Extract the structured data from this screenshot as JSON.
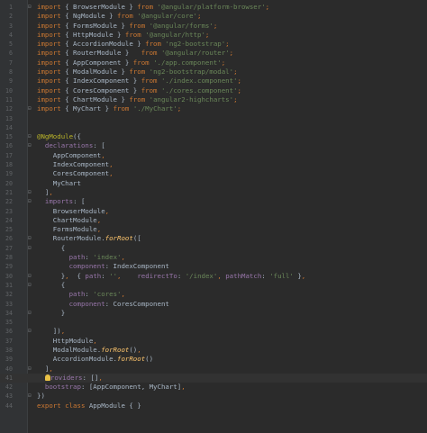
{
  "editor": {
    "lines": [
      {
        "n": "1",
        "tokens": [
          [
            "kw",
            "import"
          ],
          [
            "t",
            " { BrowserModule } "
          ],
          [
            "kw",
            "from"
          ],
          [
            "t",
            " "
          ],
          [
            "str",
            "'@angular/platform-browser'"
          ],
          [
            "kw",
            ";"
          ]
        ]
      },
      {
        "n": "2",
        "tokens": [
          [
            "kw",
            "import"
          ],
          [
            "t",
            " { NgModule } "
          ],
          [
            "kw",
            "from"
          ],
          [
            "t",
            " "
          ],
          [
            "str",
            "'@angular/core'"
          ],
          [
            "kw",
            ";"
          ]
        ]
      },
      {
        "n": "3",
        "tokens": [
          [
            "kw",
            "import"
          ],
          [
            "t",
            " { FormsModule } "
          ],
          [
            "kw",
            "from"
          ],
          [
            "t",
            " "
          ],
          [
            "str",
            "'@angular/forms'"
          ],
          [
            "kw",
            ";"
          ]
        ]
      },
      {
        "n": "4",
        "tokens": [
          [
            "kw",
            "import"
          ],
          [
            "t",
            " { HttpModule } "
          ],
          [
            "kw",
            "from"
          ],
          [
            "t",
            " "
          ],
          [
            "str",
            "'@angular/http'"
          ],
          [
            "kw",
            ";"
          ]
        ]
      },
      {
        "n": "5",
        "tokens": [
          [
            "kw",
            "import"
          ],
          [
            "t",
            " { AccordionModule } "
          ],
          [
            "kw",
            "from"
          ],
          [
            "t",
            " "
          ],
          [
            "str",
            "'ng2-bootstrap'"
          ],
          [
            "kw",
            ";"
          ]
        ]
      },
      {
        "n": "6",
        "tokens": [
          [
            "kw",
            "import"
          ],
          [
            "t",
            " { RouterModule }   "
          ],
          [
            "kw",
            "from"
          ],
          [
            "t",
            " "
          ],
          [
            "str",
            "'@angular/router'"
          ],
          [
            "kw",
            ";"
          ]
        ]
      },
      {
        "n": "7",
        "tokens": [
          [
            "kw",
            "import"
          ],
          [
            "t",
            " { AppComponent } "
          ],
          [
            "kw",
            "from"
          ],
          [
            "t",
            " "
          ],
          [
            "str",
            "'./app.component'"
          ],
          [
            "kw",
            ";"
          ]
        ]
      },
      {
        "n": "8",
        "tokens": [
          [
            "kw",
            "import"
          ],
          [
            "t",
            " { ModalModule } "
          ],
          [
            "kw",
            "from"
          ],
          [
            "t",
            " "
          ],
          [
            "str",
            "'ng2-bootstrap/modal'"
          ],
          [
            "kw",
            ";"
          ]
        ]
      },
      {
        "n": "9",
        "tokens": [
          [
            "kw",
            "import"
          ],
          [
            "t",
            " { IndexComponent } "
          ],
          [
            "kw",
            "from"
          ],
          [
            "t",
            " "
          ],
          [
            "str",
            "'./index.component'"
          ],
          [
            "kw",
            ";"
          ]
        ]
      },
      {
        "n": "10",
        "tokens": [
          [
            "kw",
            "import"
          ],
          [
            "t",
            " { CoresComponent } "
          ],
          [
            "kw",
            "from"
          ],
          [
            "t",
            " "
          ],
          [
            "str",
            "'./cores.component'"
          ],
          [
            "kw",
            ";"
          ]
        ]
      },
      {
        "n": "11",
        "tokens": [
          [
            "kw",
            "import"
          ],
          [
            "t",
            " { ChartModule } "
          ],
          [
            "kw",
            "from"
          ],
          [
            "t",
            " "
          ],
          [
            "str",
            "'angular2-highcharts'"
          ],
          [
            "kw",
            ";"
          ]
        ]
      },
      {
        "n": "12",
        "tokens": [
          [
            "kw",
            "import"
          ],
          [
            "t",
            " { MyChart } "
          ],
          [
            "kw",
            "from"
          ],
          [
            "t",
            " "
          ],
          [
            "str",
            "'./MyChart'"
          ],
          [
            "kw",
            ";"
          ]
        ]
      },
      {
        "n": "13",
        "tokens": []
      },
      {
        "n": "14",
        "tokens": []
      },
      {
        "n": "15",
        "tokens": [
          [
            "dec",
            "@NgModule"
          ],
          [
            "t",
            "({"
          ]
        ]
      },
      {
        "n": "16",
        "tokens": [
          [
            "t",
            "  "
          ],
          [
            "prop",
            "declarations"
          ],
          [
            "t",
            ": ["
          ]
        ]
      },
      {
        "n": "17",
        "tokens": [
          [
            "t",
            "    AppComponent"
          ],
          [
            "kw",
            ","
          ]
        ]
      },
      {
        "n": "18",
        "tokens": [
          [
            "t",
            "    IndexComponent"
          ],
          [
            "kw",
            ","
          ]
        ]
      },
      {
        "n": "19",
        "tokens": [
          [
            "t",
            "    CoresComponent"
          ],
          [
            "kw",
            ","
          ]
        ]
      },
      {
        "n": "20",
        "tokens": [
          [
            "t",
            "    MyChart"
          ]
        ]
      },
      {
        "n": "21",
        "tokens": [
          [
            "t",
            "  ]"
          ],
          [
            "kw",
            ","
          ]
        ]
      },
      {
        "n": "22",
        "tokens": [
          [
            "t",
            "  "
          ],
          [
            "prop",
            "imports"
          ],
          [
            "t",
            ": ["
          ]
        ]
      },
      {
        "n": "23",
        "tokens": [
          [
            "t",
            "    BrowserModule"
          ],
          [
            "kw",
            ","
          ]
        ]
      },
      {
        "n": "24",
        "tokens": [
          [
            "t",
            "    ChartModule"
          ],
          [
            "kw",
            ","
          ]
        ]
      },
      {
        "n": "25",
        "tokens": [
          [
            "t",
            "    FormsModule"
          ],
          [
            "kw",
            ","
          ]
        ]
      },
      {
        "n": "26",
        "tokens": [
          [
            "t",
            "    RouterModule."
          ],
          [
            "fn",
            "forRoot"
          ],
          [
            "t",
            "(["
          ]
        ]
      },
      {
        "n": "27",
        "tokens": [
          [
            "t",
            "      {"
          ]
        ]
      },
      {
        "n": "28",
        "tokens": [
          [
            "t",
            "        "
          ],
          [
            "prop",
            "path"
          ],
          [
            "t",
            ": "
          ],
          [
            "str",
            "'index'"
          ],
          [
            "kw",
            ","
          ]
        ]
      },
      {
        "n": "29",
        "tokens": [
          [
            "t",
            "        "
          ],
          [
            "prop",
            "component"
          ],
          [
            "t",
            ": IndexComponent"
          ]
        ]
      },
      {
        "n": "30",
        "tokens": [
          [
            "t",
            "      }"
          ],
          [
            "kw",
            ","
          ],
          [
            "t",
            "  { "
          ],
          [
            "prop",
            "path"
          ],
          [
            "t",
            ": "
          ],
          [
            "str",
            "''"
          ],
          [
            "kw",
            ","
          ],
          [
            "t",
            "    "
          ],
          [
            "prop",
            "redirectTo"
          ],
          [
            "t",
            ": "
          ],
          [
            "str",
            "'/index'"
          ],
          [
            "kw",
            ","
          ],
          [
            "t",
            " "
          ],
          [
            "prop",
            "pathMatch"
          ],
          [
            "t",
            ": "
          ],
          [
            "str",
            "'full'"
          ],
          [
            "t",
            " }"
          ],
          [
            "kw",
            ","
          ]
        ]
      },
      {
        "n": "31",
        "tokens": [
          [
            "t",
            "      {"
          ]
        ]
      },
      {
        "n": "32",
        "tokens": [
          [
            "t",
            "        "
          ],
          [
            "prop",
            "path"
          ],
          [
            "t",
            ": "
          ],
          [
            "str",
            "'cores'"
          ],
          [
            "kw",
            ","
          ]
        ]
      },
      {
        "n": "33",
        "tokens": [
          [
            "t",
            "        "
          ],
          [
            "prop",
            "component"
          ],
          [
            "t",
            ": CoresComponent"
          ]
        ]
      },
      {
        "n": "34",
        "tokens": [
          [
            "t",
            "      }"
          ]
        ]
      },
      {
        "n": "35",
        "tokens": []
      },
      {
        "n": "36",
        "tokens": [
          [
            "t",
            "    ])"
          ],
          [
            "kw",
            ","
          ]
        ]
      },
      {
        "n": "37",
        "tokens": [
          [
            "t",
            "    HttpModule"
          ],
          [
            "kw",
            ","
          ]
        ]
      },
      {
        "n": "38",
        "tokens": [
          [
            "t",
            "    ModalModule."
          ],
          [
            "fn",
            "forRoot"
          ],
          [
            "t",
            "()"
          ],
          [
            "kw",
            ","
          ]
        ]
      },
      {
        "n": "39",
        "tokens": [
          [
            "t",
            "    AccordionModule."
          ],
          [
            "fn",
            "forRoot"
          ],
          [
            "t",
            "()"
          ]
        ]
      },
      {
        "n": "40",
        "tokens": [
          [
            "t",
            "  ]"
          ],
          [
            "kw",
            ","
          ]
        ]
      },
      {
        "n": "41",
        "tokens": [
          [
            "t",
            "  "
          ],
          [
            "bulb",
            ""
          ],
          [
            "prop",
            "roviders"
          ],
          [
            "t",
            ": []"
          ],
          [
            "kw",
            ","
          ]
        ]
      },
      {
        "n": "42",
        "tokens": [
          [
            "t",
            "  "
          ],
          [
            "prop",
            "bootstrap"
          ],
          [
            "t",
            ": [AppComponent, MyChart]"
          ],
          [
            "kw",
            ","
          ]
        ]
      },
      {
        "n": "43",
        "tokens": [
          [
            "t",
            "})"
          ]
        ]
      },
      {
        "n": "44",
        "tokens": [
          [
            "kw",
            "export class"
          ],
          [
            "t",
            " AppModule { }"
          ]
        ]
      }
    ],
    "current_line": "41",
    "fold_markers": {
      "1": "⊟",
      "12": "⊟",
      "15": "⊟",
      "16": "⊟",
      "21": "⊟",
      "22": "⊟",
      "26": "⊟",
      "27": "⊟",
      "30": "⊟",
      "31": "⊟",
      "34": "⊟",
      "36": "⊟",
      "40": "⊟",
      "43": "⊟"
    },
    "colors": {
      "background": "#2b2b2b",
      "keyword": "#cc7832",
      "string": "#6a8759",
      "decorator": "#bbb529",
      "property": "#9876aa",
      "method": "#ffc66d",
      "text": "#a9b7c6",
      "line_number": "#606366"
    },
    "icons": {
      "intention": "lightbulb-icon",
      "fold": "fold-marker-icon"
    }
  }
}
